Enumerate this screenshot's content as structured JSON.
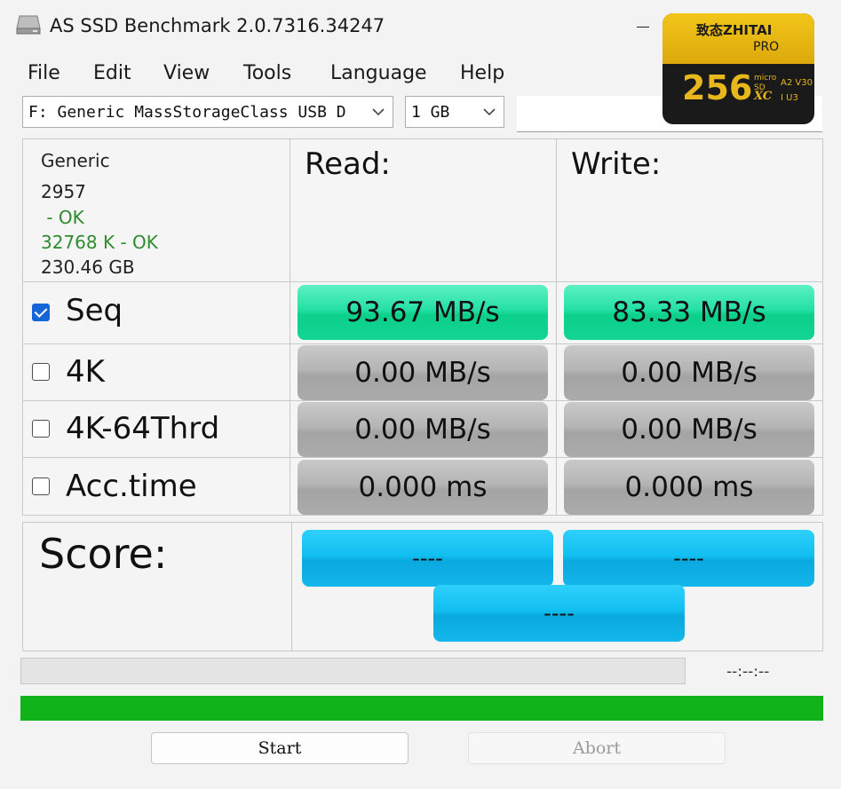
{
  "window": {
    "title": "AS SSD Benchmark 2.0.7316.34247"
  },
  "menu": {
    "items": [
      "File",
      "Edit",
      "View",
      "Tools",
      "Language",
      "Help"
    ]
  },
  "drive_select": {
    "value": "F: Generic MassStorageClass USB D"
  },
  "size_select": {
    "value": "1 GB"
  },
  "drive_info": {
    "vendor": "Generic",
    "firmware": "2957",
    "driver_status": " - OK",
    "alignment": "32768 K - OK",
    "capacity": "230.46 GB"
  },
  "headers": {
    "read": "Read:",
    "write": "Write:"
  },
  "tests": [
    {
      "label": "Seq",
      "checked": true,
      "read": "93.67 MB/s",
      "write": "83.33 MB/s"
    },
    {
      "label": "4K",
      "checked": false,
      "read": "0.00 MB/s",
      "write": "0.00 MB/s"
    },
    {
      "label": "4K-64Thrd",
      "checked": false,
      "read": "0.00 MB/s",
      "write": "0.00 MB/s"
    },
    {
      "label": "Acc.time",
      "checked": false,
      "read": "0.000 ms",
      "write": "0.000 ms"
    }
  ],
  "score": {
    "label": "Score:",
    "read": "----",
    "write": "----",
    "total": "----"
  },
  "status": {
    "elapsed": "--:--:--",
    "progress_fraction": 1.0
  },
  "buttons": {
    "start": "Start",
    "abort": "Abort"
  },
  "product_overlay": {
    "brand": "致态ZHITAI",
    "line": "PRO",
    "capacity": "256",
    "micro": "micro",
    "sd": "SD",
    "xc": "XC",
    "class_a2": "A2",
    "class_v30": "V30",
    "class_i": "I",
    "class_u3": "U3"
  },
  "colors": {
    "result_green": "#12d595",
    "result_gray": "#b0b0b0",
    "score_blue": "#11bff0",
    "progress_green": "#10b41a",
    "ok_green": "#2e8b2e",
    "checkbox_blue": "#1565d8"
  }
}
